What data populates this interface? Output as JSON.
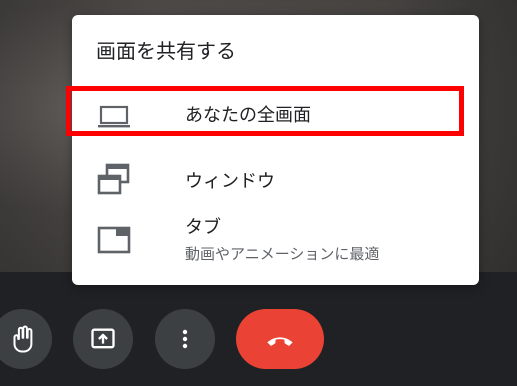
{
  "share_menu": {
    "title": "画面を共有する",
    "items": [
      {
        "label": "あなたの全画面",
        "icon": "laptop-icon"
      },
      {
        "label": "ウィンドウ",
        "icon": "window-icon"
      },
      {
        "label": "タブ",
        "sublabel": "動画やアニメーションに最適",
        "icon": "tab-icon"
      }
    ]
  },
  "controls": [
    {
      "icon": "raise-hand-icon"
    },
    {
      "icon": "present-screen-icon"
    },
    {
      "icon": "more-vert-icon"
    },
    {
      "icon": "end-call-icon"
    }
  ],
  "colors": {
    "highlight": "#ff0000",
    "end_call": "#ea4335",
    "control_bg": "#3c4043",
    "bar_bg": "#202124"
  }
}
